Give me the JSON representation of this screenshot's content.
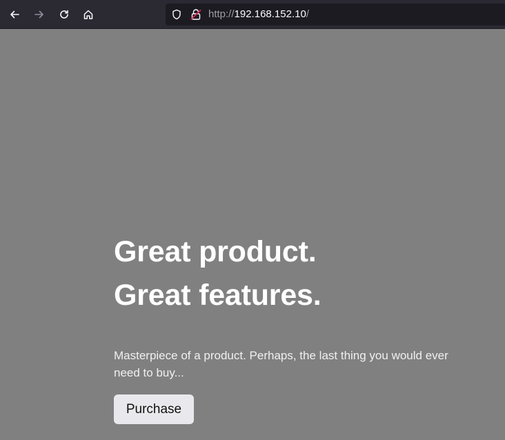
{
  "browser": {
    "url_scheme": "http://",
    "url_host": "192.168.152.10",
    "url_tail": "/",
    "icons": [
      "back-arrow-icon",
      "forward-arrow-icon",
      "reload-icon",
      "home-icon",
      "shield-icon",
      "insecure-lock-icon"
    ]
  },
  "hero": {
    "title_line1": "Great product.",
    "title_line2": "Great features.",
    "lead": "Masterpiece of a product. Perhaps, the last thing you would ever need to buy...",
    "button_label": "Purchase"
  },
  "colors": {
    "page_background": "#808080",
    "toolbar_background": "#2b2a33",
    "url_bar_background": "#1c1b22",
    "button_background": "#e9e9ed",
    "insecure_accent": "#e22850"
  }
}
